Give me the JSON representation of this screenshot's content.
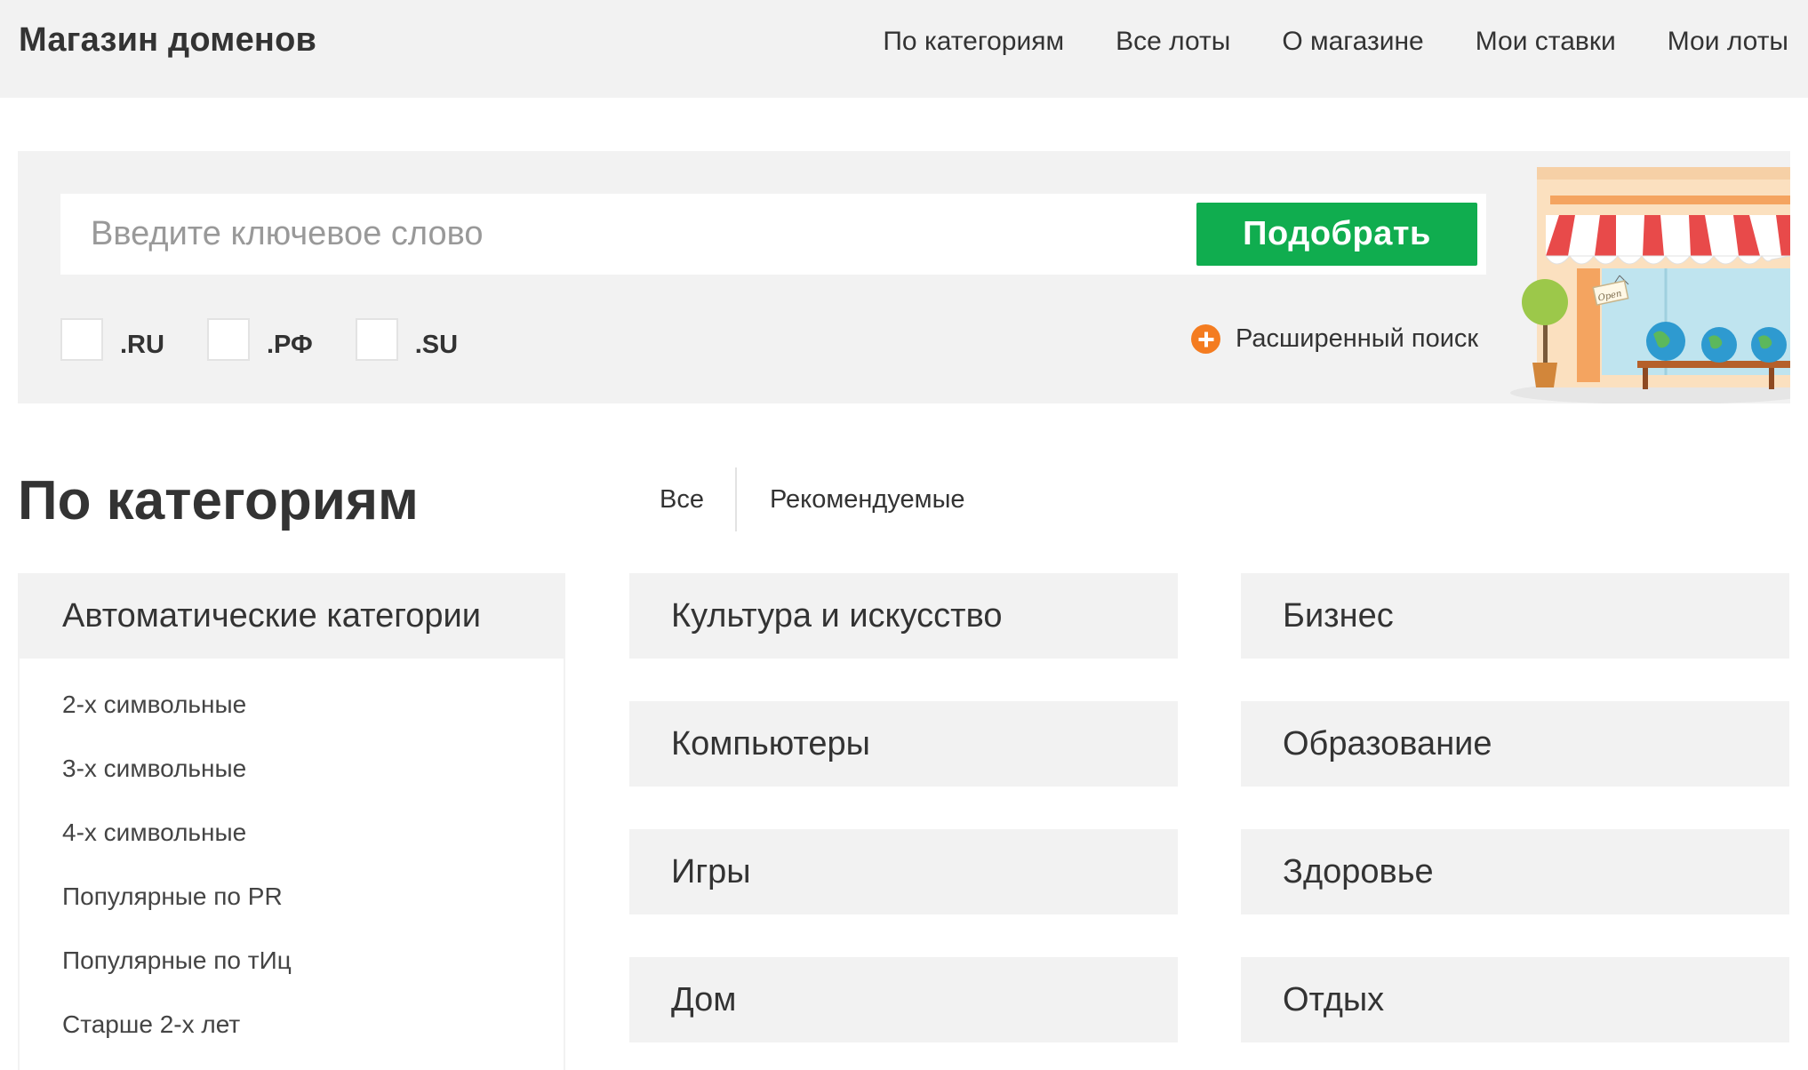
{
  "header": {
    "brand": "Магазин доменов",
    "nav": [
      "По категориям",
      "Все лоты",
      "О магазине",
      "Мои ставки",
      "Мои лоты"
    ]
  },
  "search": {
    "placeholder": "Введите ключевое слово",
    "button_label": "Подобрать",
    "tlds": [
      ".RU",
      ".РФ",
      ".SU"
    ],
    "advanced_label": "Расширенный поиск",
    "shop_sign": "Open"
  },
  "categories": {
    "title": "По категориям",
    "filters": [
      "Все",
      "Рекомендуемые"
    ],
    "auto_title": "Автоматические категории",
    "auto_items": [
      "2-х символьные",
      "3-х символьные",
      "4-х символьные",
      "Популярные по PR",
      "Популярные по тИц",
      "Старше 2-х лет"
    ],
    "column_2": [
      "Культура и искусство",
      "Компьютеры",
      "Игры",
      "Дом"
    ],
    "column_3": [
      "Бизнес",
      "Образование",
      "Здоровье",
      "Отдых"
    ]
  },
  "colors": {
    "accent_green": "#10ad4f",
    "accent_orange": "#f47c20",
    "panel_gray": "#f2f2f2"
  }
}
